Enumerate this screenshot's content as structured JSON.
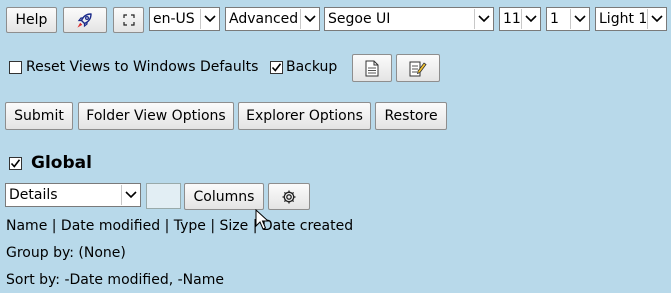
{
  "toolbar": {
    "help_label": "Help",
    "rocket_icon": "rocket-icon",
    "fullscreen_icon": "fullscreen-icon",
    "language": "en-US",
    "mode": "Advanced",
    "font": "Segoe UI",
    "size": "11",
    "line": "1",
    "theme": "Light 1"
  },
  "options": {
    "reset_label": "Reset Views to Windows Defaults",
    "reset_checked": false,
    "backup_label": "Backup",
    "backup_checked": true,
    "doc_icon": "document-icon",
    "notes_icon": "notes-icon"
  },
  "actions": {
    "submit": "Submit",
    "folder_view": "Folder View Options",
    "explorer": "Explorer Options",
    "restore": "Restore"
  },
  "global": {
    "title": "Global",
    "checked": true,
    "view": "Details",
    "columns_label": "Columns",
    "settings_icon": "gear-icon",
    "columns_list": "Name | Date modified | Type | Size | Date created",
    "group_by": "Group by: (None)",
    "sort_by": "Sort by: -Date modified, -Name"
  },
  "colors": {
    "background": "#b8d9ea",
    "button": "#efefef"
  }
}
